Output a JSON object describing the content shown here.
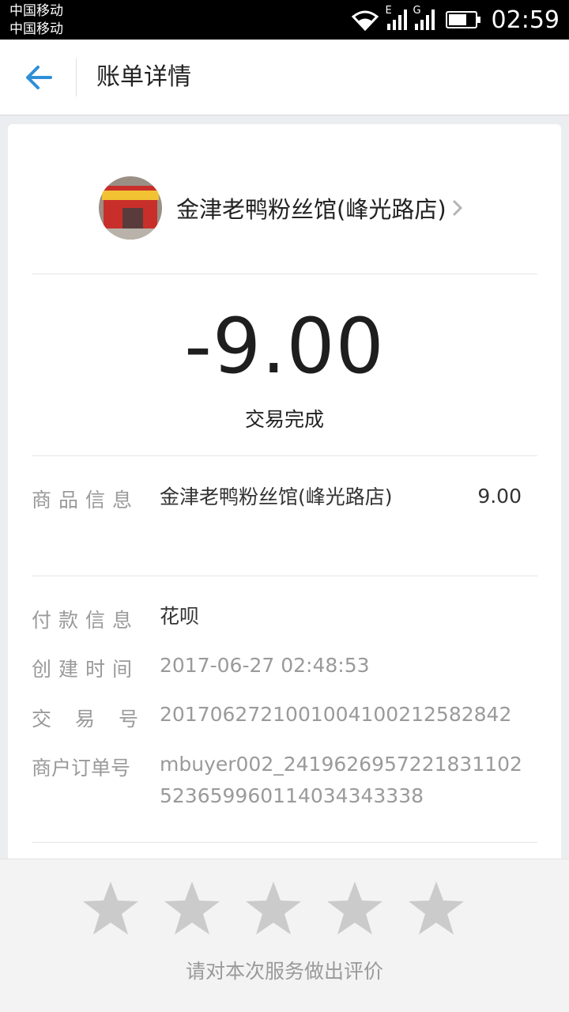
{
  "status_bar": {
    "carrier_1": "中国移动",
    "carrier_2": "中国移动",
    "signal_1_type": "E",
    "signal_2_type": "G",
    "battery_level": 0.7,
    "time": "02:59"
  },
  "header": {
    "back_icon": "back-arrow-icon",
    "title": "账单详情"
  },
  "merchant": {
    "name": "金津老鸭粉丝馆(峰光路店)",
    "chevron_icon": "chevron-right-icon"
  },
  "transaction": {
    "amount": "-9.00",
    "status": "交易完成"
  },
  "details": {
    "goods_label": "商品信息",
    "goods_name": "金津老鸭粉丝馆(峰光路店)",
    "goods_price": "9.00",
    "payment_label": "付款信息",
    "payment_value": "花呗",
    "created_label": "创建时间",
    "created_value": "2017-06-27 02:48:53",
    "trade_no_label": "交易号",
    "trade_no_value": "2017062721001004100212582842",
    "order_no_label": "商户订单号",
    "order_no_value": "mbuyer002_2419626957221831102523659960114034343338"
  },
  "rating": {
    "star_icon": "star-icon",
    "stars_count": 5,
    "filled": 0,
    "hint": "请对本次服务做出评价"
  },
  "colors": {
    "accent": "#2f8fd8",
    "star_gray": "#cbcbcb",
    "label_gray": "#9a9a9a"
  }
}
